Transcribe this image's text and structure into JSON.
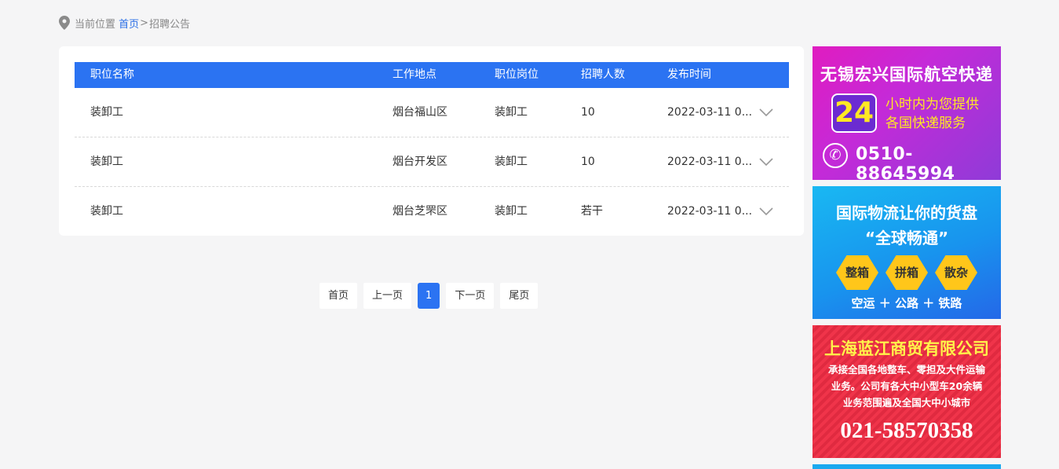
{
  "breadcrumb": {
    "prefix": "当前位置",
    "home": "首页",
    "separator": ">",
    "current": "招聘公告"
  },
  "table": {
    "headers": [
      "职位名称",
      "工作地点",
      "职位岗位",
      "招聘人数",
      "发布时间"
    ],
    "rows": [
      [
        "装卸工",
        "烟台福山区",
        "装卸工",
        "10",
        "2022-03-11 0..."
      ],
      [
        "装卸工",
        "烟台开发区",
        "装卸工",
        "10",
        "2022-03-11 0..."
      ],
      [
        "装卸工",
        "烟台芝罘区",
        "装卸工",
        "若干",
        "2022-03-11 0..."
      ]
    ]
  },
  "pagination": {
    "first": "首页",
    "prev": "上一页",
    "current": "1",
    "next": "下一页",
    "last": "尾页"
  },
  "ads": [
    {
      "title": "无锡宏兴国际航空快递",
      "highlight": "24",
      "line1": "小时内为您提供",
      "line2": "各国快递服务",
      "phone": "0510-88645994",
      "icon": "phone-icon"
    },
    {
      "title": "国际物流让你的货盘",
      "subtitle": "“全球畅通”",
      "tags": [
        "整箱",
        "拼箱",
        "散杂"
      ],
      "footer": "空运 ＋ 公路 ＋ 铁路"
    },
    {
      "title": "上海蓝江商贸有限公司",
      "lines": [
        "承接全国各地整车、零担及大件运输",
        "业务。公司有各大中小型车20余辆",
        "业务范围遍及全国大中小城市"
      ],
      "phone": "021-58570358"
    }
  ],
  "colors": {
    "accent": "#2b73f2",
    "background": "#f5f5f6",
    "link": "#2a6fe6"
  }
}
